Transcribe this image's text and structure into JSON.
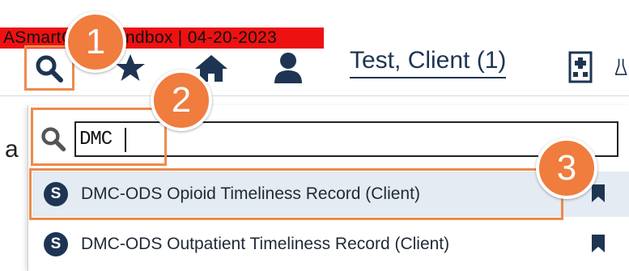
{
  "banner": {
    "text": "ASmartCare Sandbox | 04-20-2023",
    "color": "#ee1111"
  },
  "toolbar": {
    "icons": [
      "search-icon",
      "star-icon",
      "home-icon",
      "user-icon",
      "hospital-icon"
    ],
    "client_name": "Test, Client (1)"
  },
  "callouts": [
    "1",
    "2",
    "3"
  ],
  "search": {
    "value": "DMC"
  },
  "page": {
    "partial_title_letter": "a"
  },
  "results": [
    {
      "badge": "S",
      "label": "DMC-ODS Opioid Timeliness Record (Client)",
      "icon": "bookmark-icon"
    },
    {
      "badge": "S",
      "label": "DMC-ODS Outpatient Timeliness Record (Client)",
      "icon": "bookmark-icon"
    }
  ],
  "colors": {
    "accent": "#f07c3e",
    "navy": "#1d3553",
    "selected_row": "#e4ebf2"
  }
}
